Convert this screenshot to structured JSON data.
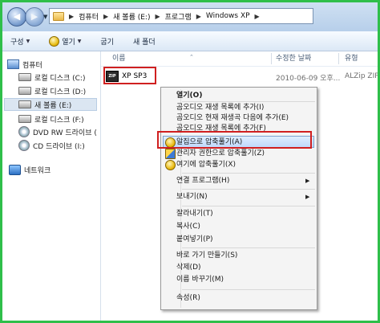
{
  "address": {
    "crumbs": [
      "컴퓨터",
      "새 볼륨 (E:)",
      "프로그램",
      "Windows XP"
    ]
  },
  "toolbar": {
    "organize": "구성",
    "open": "열기",
    "burn": "굽기",
    "new_folder": "새 폴더"
  },
  "nav": {
    "computer": "컴퓨터",
    "drives": [
      "로컬 디스크 (C:)",
      "로컬 디스크 (D:)",
      "새 볼륨 (E:)",
      "로컬 디스크 (F:)",
      "DVD RW 드라이브 (",
      "CD 드라이브 (I:)"
    ],
    "network": "네트워크"
  },
  "columns": {
    "name": "이름",
    "date": "수정한 날짜",
    "type": "유형"
  },
  "file": {
    "icon_text": "ZIP",
    "name": "XP SP3",
    "date": "2010-06-09 오후...",
    "type": "ALZip ZIP"
  },
  "context_menu": {
    "items": [
      "열기(O)",
      "곰오디오 재생 목록에 추가(I)",
      "곰오디오 현재 재생곡 다음에 추가(E)",
      "곰오디오 재생 목록에 추가(F)",
      "알집으로 압축풀기(A)",
      "관리자 권한으로 압축풀기(Z)",
      "여기에 압축풀기(X)",
      "연결 프로그램(H)",
      "보내기(N)",
      "잘라내기(T)",
      "복사(C)",
      "붙여넣기(P)",
      "바로 가기 만들기(S)",
      "삭제(D)",
      "이름 바꾸기(M)",
      "속성(R)"
    ]
  },
  "colors": {
    "frame_border": "#2fbf4a",
    "annotation_red": "#d02020"
  }
}
